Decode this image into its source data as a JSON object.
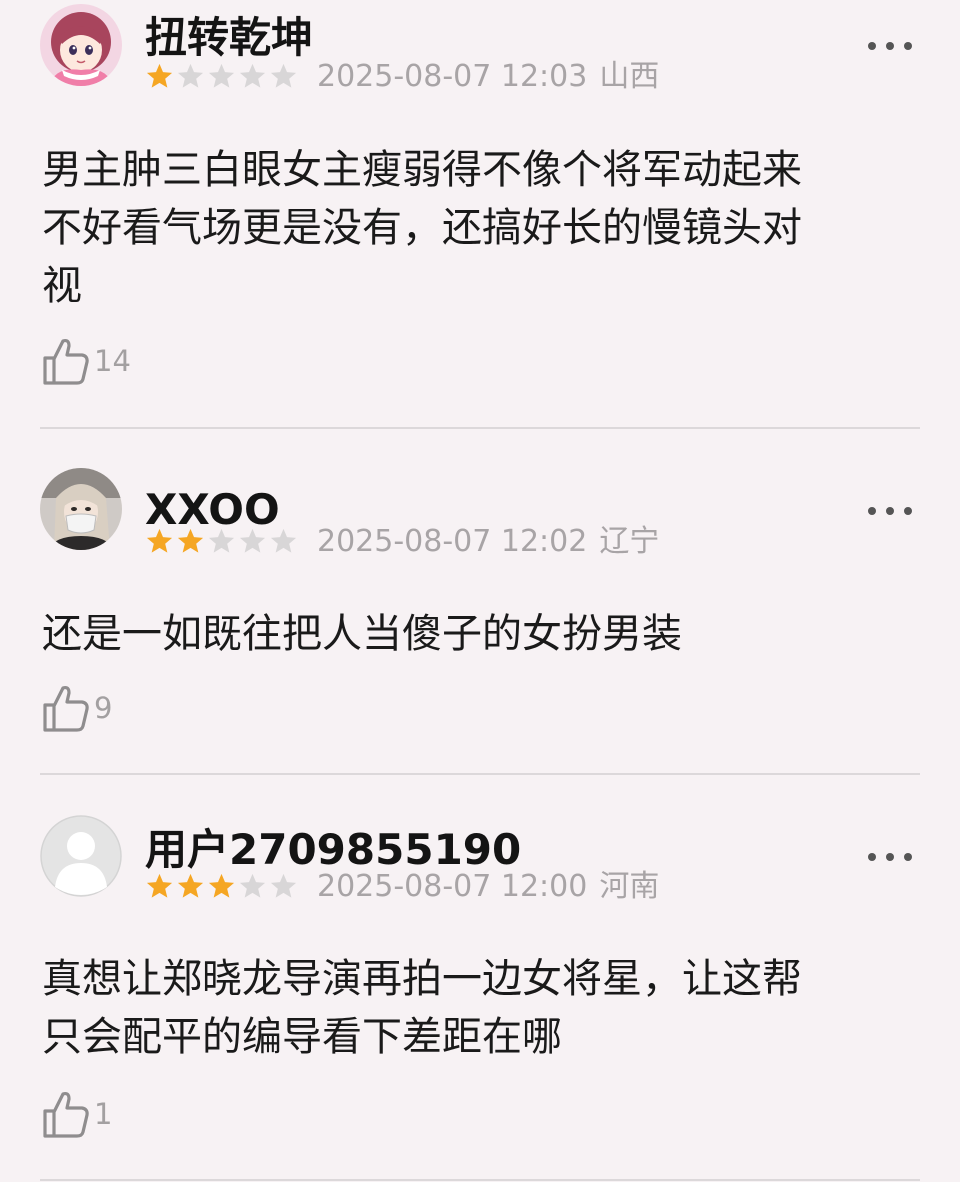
{
  "reviews": [
    {
      "username": "扭转乾坤",
      "rating": 1,
      "max_rating": 5,
      "date": "2025-08-07 12:03",
      "location": "山西",
      "text": "男主肿三白眼女主瘦弱得不像个将军动起来\n不好看气场更是没有，还搞好长的慢镜头对\n视",
      "likes": "14",
      "avatar": "anime-girl-avatar"
    },
    {
      "username": "XXOO",
      "rating": 2,
      "max_rating": 5,
      "date": "2025-08-07 12:02",
      "location": "辽宁",
      "text": "还是一如既往把人当傻子的女扮男装",
      "likes": "9",
      "avatar": "masked-woman-avatar"
    },
    {
      "username": "用户2709855190",
      "rating": 3,
      "max_rating": 5,
      "date": "2025-08-07 12:00",
      "location": "河南",
      "text": "真想让郑晓龙导演再拍一边女将星，让这帮\n只会配平的编导看下差距在哪",
      "likes": "1",
      "avatar": "default-user-avatar"
    }
  ],
  "colors": {
    "background": "#f7f2f4",
    "star_filled": "#f5a623",
    "star_empty": "#d8d6d7",
    "meta_text": "#a8a4a6",
    "divider": "#dcd8da"
  },
  "icons": {
    "like": "thumbs-up-icon",
    "more": "more-dots-icon",
    "star": "star-icon"
  }
}
